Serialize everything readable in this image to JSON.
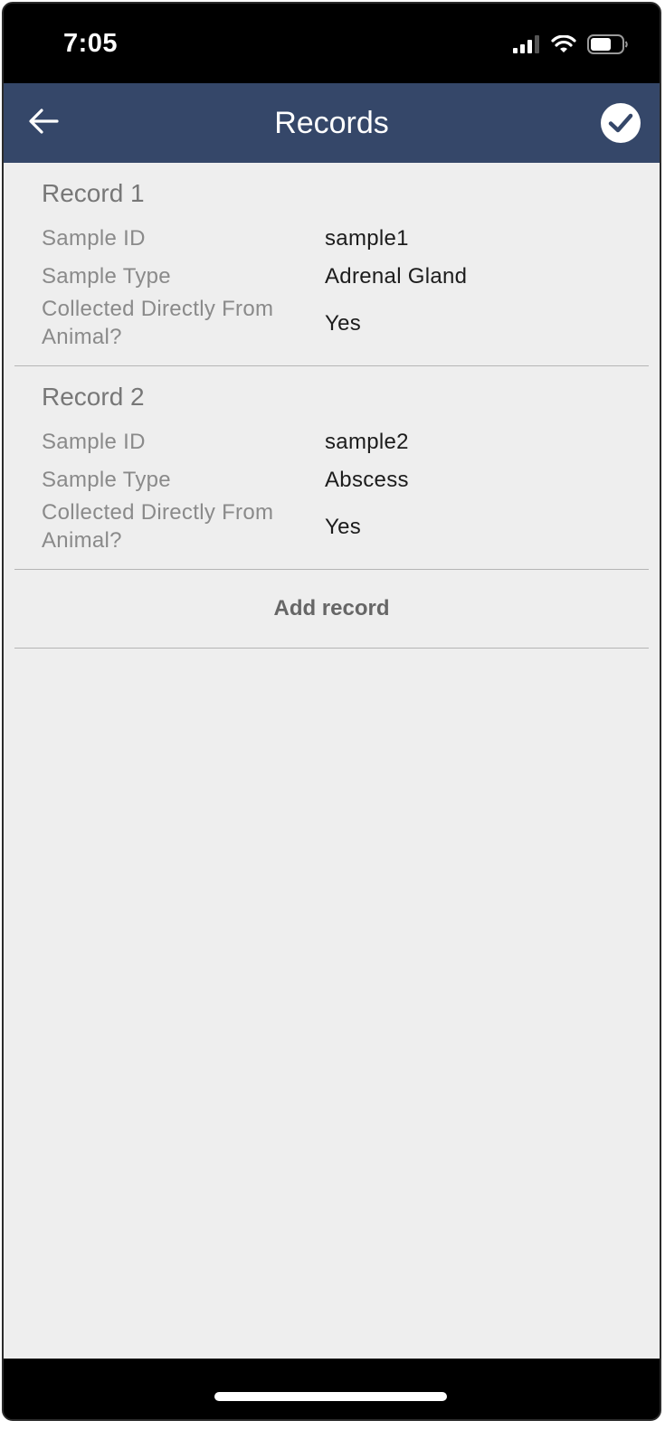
{
  "status_bar": {
    "time": "7:05",
    "icons": [
      "cellular-signal-icon",
      "wifi-icon",
      "battery-icon"
    ]
  },
  "app_bar": {
    "title": "Records",
    "back_icon": "arrow-left-icon",
    "done_icon": "check-circle-icon",
    "background_color": "#354769"
  },
  "records": [
    {
      "title": "Record 1",
      "fields": [
        {
          "label": "Sample ID",
          "value": "sample1"
        },
        {
          "label": "Sample Type",
          "value": "Adrenal Gland"
        },
        {
          "label": "Collected Directly From Animal?",
          "value": "Yes"
        }
      ]
    },
    {
      "title": "Record 2",
      "fields": [
        {
          "label": "Sample ID",
          "value": "sample2"
        },
        {
          "label": "Sample Type",
          "value": "Abscess"
        },
        {
          "label": "Collected Directly From Animal?",
          "value": "Yes"
        }
      ]
    }
  ],
  "add_record_label": "Add record"
}
